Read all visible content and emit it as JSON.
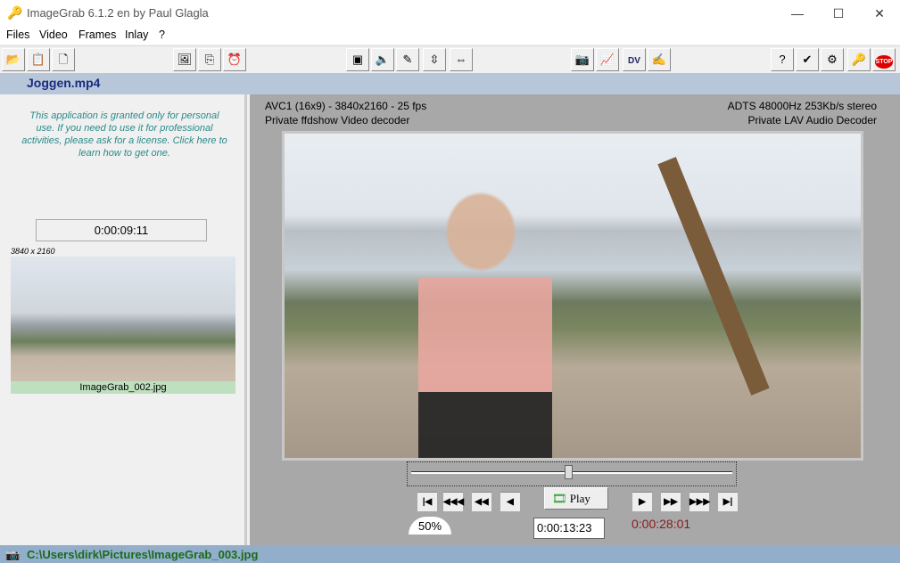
{
  "window": {
    "title": "ImageGrab 6.1.2 en by Paul Glagla",
    "minimize": "—",
    "maximize": "☐",
    "close": "✕"
  },
  "menu": [
    "Files",
    "Video",
    "Frames",
    "Inlay",
    "?"
  ],
  "toolbar": [
    {
      "name": "open-icon",
      "glyph": "📂"
    },
    {
      "name": "paste-icon",
      "glyph": "📋"
    },
    {
      "name": "close-file-icon",
      "glyph": "🗋"
    },
    {
      "name": "export-image-icon",
      "glyph": "🖼"
    },
    {
      "name": "copy-icon",
      "glyph": "⎘"
    },
    {
      "name": "alarm-icon",
      "glyph": "⏰"
    },
    {
      "name": "display-icon",
      "glyph": "▣"
    },
    {
      "name": "sound-icon",
      "glyph": "🔈"
    },
    {
      "name": "edit-icon",
      "glyph": "✎"
    },
    {
      "name": "fit-vertical-icon",
      "glyph": "⇳"
    },
    {
      "name": "fit-horizontal-icon",
      "glyph": "⇔"
    },
    {
      "name": "camera-icon",
      "glyph": "📷"
    },
    {
      "name": "chart-icon",
      "glyph": "📈"
    },
    {
      "name": "dv-icon",
      "glyph": "DV"
    },
    {
      "name": "image-edit-icon",
      "glyph": "✍"
    },
    {
      "name": "help-icon",
      "glyph": "?"
    },
    {
      "name": "check-icon",
      "glyph": "✔"
    },
    {
      "name": "settings-icon",
      "glyph": "⚙"
    },
    {
      "name": "plugin-icon",
      "glyph": "🔑"
    },
    {
      "name": "stop-icon",
      "glyph": "STOP"
    }
  ],
  "file": {
    "name": "Joggen.mp4"
  },
  "left": {
    "notice": "This application is granted only for  personal use. If you need to use it for professional activities, please ask for a license. Click here to learn how to get one.",
    "timecode": "0:00:09:11",
    "dims": "3840 x 2160",
    "thumb_caption": "ImageGrab_002.jpg"
  },
  "info": {
    "video_format": "AVC1 (16x9) - 3840x2160 - 25 fps",
    "video_decoder": "Private ffdshow Video decoder",
    "audio_format": "ADTS 48000Hz 253Kb/s stereo",
    "audio_decoder": "Private LAV Audio Decoder"
  },
  "playback": {
    "position_fraction": 0.49,
    "play_label": "Play",
    "zoom": "50%",
    "position": "0:00:13:23",
    "duration": "0:00:28:01"
  },
  "status": {
    "path": "C:\\Users\\dirk\\Pictures\\ImageGrab_003.jpg"
  }
}
